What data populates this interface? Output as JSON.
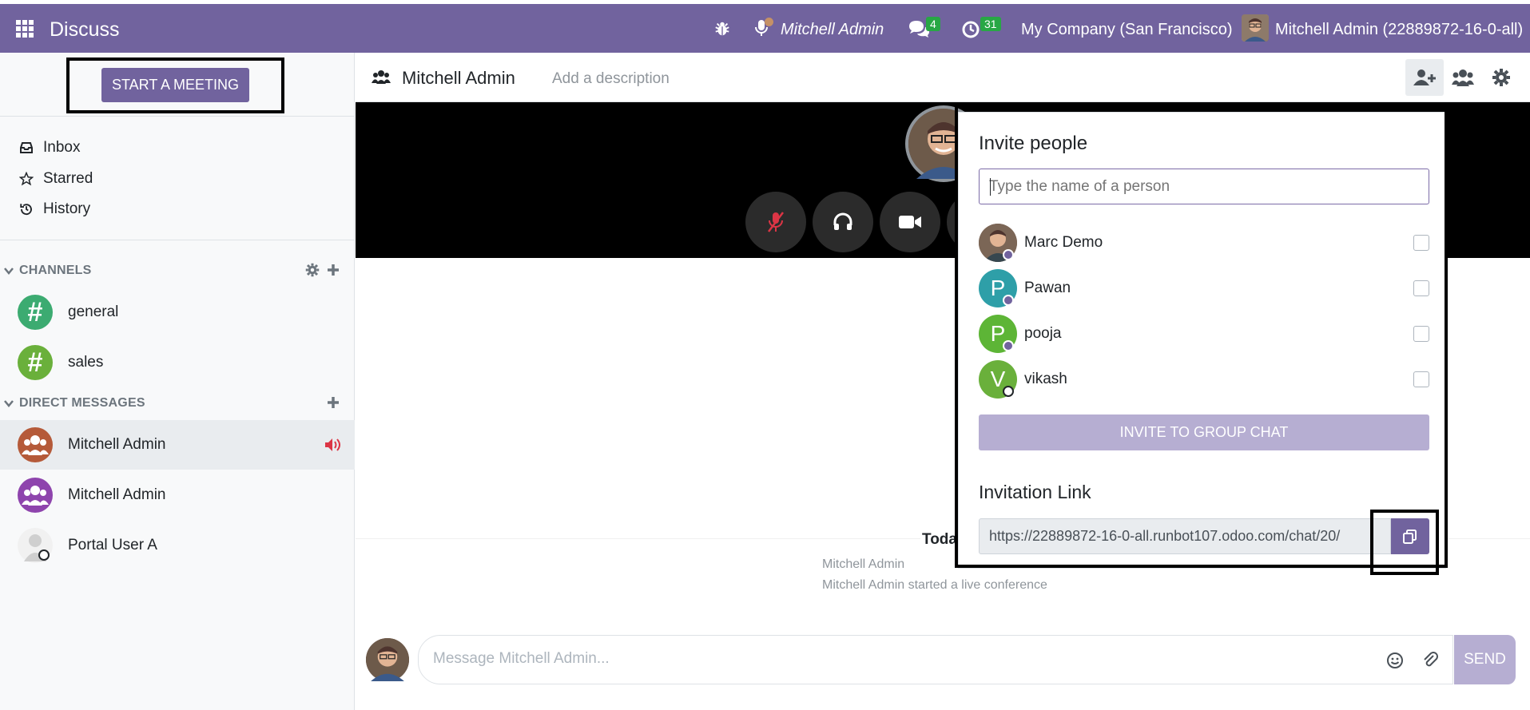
{
  "navbar": {
    "app_title": "Discuss",
    "rtc_user": "Mitchell Admin",
    "messages_count": "4",
    "activities_count": "31",
    "company": "My Company (San Francisco)",
    "user": "Mitchell Admin (22889872-16-0-all)",
    "accent": "#71639e"
  },
  "sidebar": {
    "start_meeting": "START A MEETING",
    "mailboxes": [
      {
        "label": "Inbox",
        "icon": "inbox-icon"
      },
      {
        "label": "Starred",
        "icon": "star-icon"
      },
      {
        "label": "History",
        "icon": "history-icon"
      }
    ],
    "channels_header": "CHANNELS",
    "channels": [
      {
        "label": "general",
        "color": "#3cab71"
      },
      {
        "label": "sales",
        "color": "#6ab03b"
      }
    ],
    "dm_header": "DIRECT MESSAGES",
    "direct_messages": [
      {
        "label": "Mitchell Admin",
        "color": "#b55a39",
        "active": true
      },
      {
        "label": "Mitchell Admin",
        "color": "#8e44ad"
      },
      {
        "label": "Portal User A",
        "color": "#d0d0d0"
      }
    ]
  },
  "thread": {
    "name": "Mitchell Admin",
    "description_placeholder": "Add a description"
  },
  "messages": {
    "day": "Today",
    "author": "Mitchell Admin",
    "text": "Mitchell Admin started a live conference"
  },
  "composer": {
    "placeholder": "Message Mitchell Admin...",
    "send": "SEND"
  },
  "invite": {
    "title": "Invite people",
    "search_placeholder": "Type the name of a person",
    "partners": [
      {
        "name": "Marc Demo",
        "initial": "",
        "color": "#8d6e63"
      },
      {
        "name": "Pawan",
        "initial": "P",
        "color": "#2e9fa8"
      },
      {
        "name": "pooja",
        "initial": "P",
        "color": "#5db536"
      },
      {
        "name": "vikash",
        "initial": "V",
        "color": "#6ab03b"
      }
    ],
    "invite_button": "INVITE TO GROUP CHAT",
    "link_title": "Invitation Link",
    "link_value": "https://22889872-16-0-all.runbot107.odoo.com/chat/20/"
  }
}
